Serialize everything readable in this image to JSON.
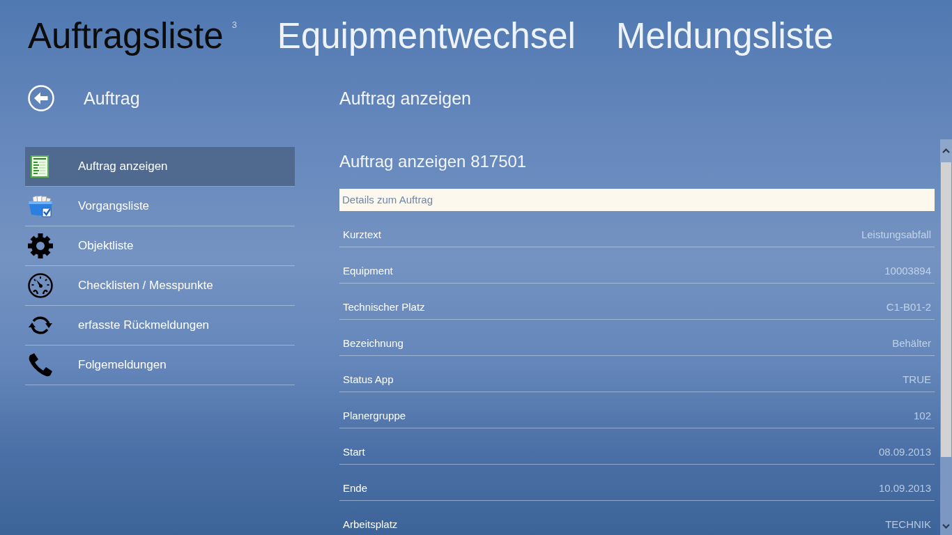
{
  "pivot": {
    "tabs": [
      {
        "label": "Auftragsliste",
        "selected": true,
        "count": "3"
      },
      {
        "label": "Equipmentwechsel",
        "selected": false
      },
      {
        "label": "Meldungsliste",
        "selected": false
      }
    ]
  },
  "sidebar": {
    "title": "Auftrag",
    "items": [
      {
        "label": "Auftrag anzeigen",
        "selected": true
      },
      {
        "label": "Vorgangsliste",
        "selected": false
      },
      {
        "label": "Objektliste",
        "selected": false
      },
      {
        "label": "Checklisten / Messpunkte",
        "selected": false
      },
      {
        "label": "erfasste Rückmeldungen",
        "selected": false
      },
      {
        "label": "Folgemeldungen",
        "selected": false
      }
    ]
  },
  "content": {
    "heading": "Auftrag anzeigen",
    "title": "Auftrag anzeigen 817501",
    "group": "Details zum Auftrag",
    "fields": [
      {
        "label": "Kurztext",
        "value": "Leistungsabfall"
      },
      {
        "label": "Equipment",
        "value": "10003894"
      },
      {
        "label": "Technischer Platz",
        "value": "C1-B01-2"
      },
      {
        "label": "Bezeichnung",
        "value": "Behälter"
      },
      {
        "label": "Status App",
        "value": "TRUE"
      },
      {
        "label": "Planergruppe",
        "value": "102"
      },
      {
        "label": "Start",
        "value": "08.09.2013"
      },
      {
        "label": "Ende",
        "value": "10.09.2013"
      },
      {
        "label": "Arbeitsplatz",
        "value": "TECHNIK"
      }
    ]
  }
}
